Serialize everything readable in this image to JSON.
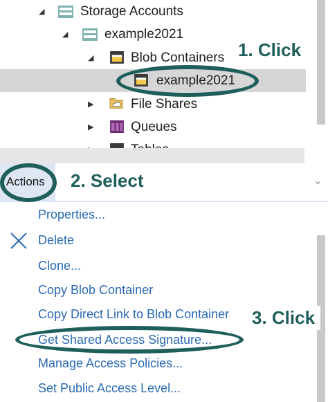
{
  "tree": {
    "items": [
      {
        "label": "Storage Accounts",
        "icon": "storage-account-icon",
        "expanded": true
      },
      {
        "label": "example2021",
        "icon": "storage-account-icon",
        "expanded": true
      },
      {
        "label": "Blob Containers",
        "icon": "blob-containers-icon",
        "expanded": true
      },
      {
        "label": "example2021",
        "icon": "blob-container-icon",
        "selected": true
      },
      {
        "label": "File Shares",
        "icon": "file-shares-icon",
        "expanded": false
      },
      {
        "label": "Queues",
        "icon": "queues-icon",
        "expanded": false
      },
      {
        "label": "Tables",
        "icon": "tables-icon",
        "expanded": false
      }
    ]
  },
  "actions": {
    "tab_label": "Actions",
    "items": [
      {
        "label": "Properties..."
      },
      {
        "label": "Delete",
        "icon": "delete-x-icon"
      },
      {
        "label": "Clone..."
      },
      {
        "label": "Copy Blob Container"
      },
      {
        "label": "Copy Direct Link to Blob Container"
      },
      {
        "label": "Get Shared Access Signature..."
      },
      {
        "label": "Manage Access Policies..."
      },
      {
        "label": "Set Public Access Level..."
      }
    ]
  },
  "annotations": {
    "step1": "1. Click",
    "step2": "2. Select",
    "step3": "3. Click"
  },
  "colors": {
    "annotation": "#1f5f5b",
    "link": "#2a6ab3",
    "selected_row": "#d6d6d6",
    "actions_tab": "#dde6f2"
  }
}
